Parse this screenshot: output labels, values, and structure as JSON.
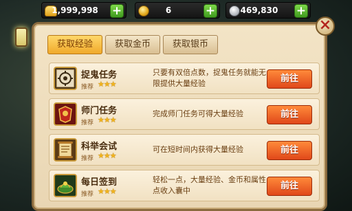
{
  "currencies": {
    "gold": {
      "value": "1,999,998",
      "icon": "gold-ingot-icon"
    },
    "coins": {
      "value": "6",
      "icon": "gold-coin-icon"
    },
    "silver": {
      "value": "469,830",
      "icon": "silver-coin-icon"
    },
    "plus_label": "+"
  },
  "close_label": "×",
  "tabs": [
    {
      "label": "获取经验",
      "active": true
    },
    {
      "label": "获取金币",
      "active": false
    },
    {
      "label": "获取银币",
      "active": false
    }
  ],
  "tasks": [
    {
      "name": "捉鬼任务",
      "recommend": "推荐",
      "stars": "★★★",
      "desc": "只要有双倍点数，捉鬼任务就能无限提供大量经验",
      "button": "前往",
      "icon": "ghost-hunt-icon"
    },
    {
      "name": "师门任务",
      "recommend": "推荐",
      "stars": "★★★",
      "desc": "完成师门任务可得大量经验",
      "button": "前往",
      "icon": "sect-task-icon"
    },
    {
      "name": "科举会试",
      "recommend": "推荐",
      "stars": "★★★",
      "desc": "可在短时间内获得大量经验",
      "button": "前往",
      "icon": "exam-scroll-icon"
    },
    {
      "name": "每日签到",
      "recommend": "推荐",
      "stars": "★★★",
      "desc": "轻松一点，大量经验、金币和属性点收入囊中",
      "button": "前往",
      "icon": "daily-sign-icon"
    }
  ]
}
